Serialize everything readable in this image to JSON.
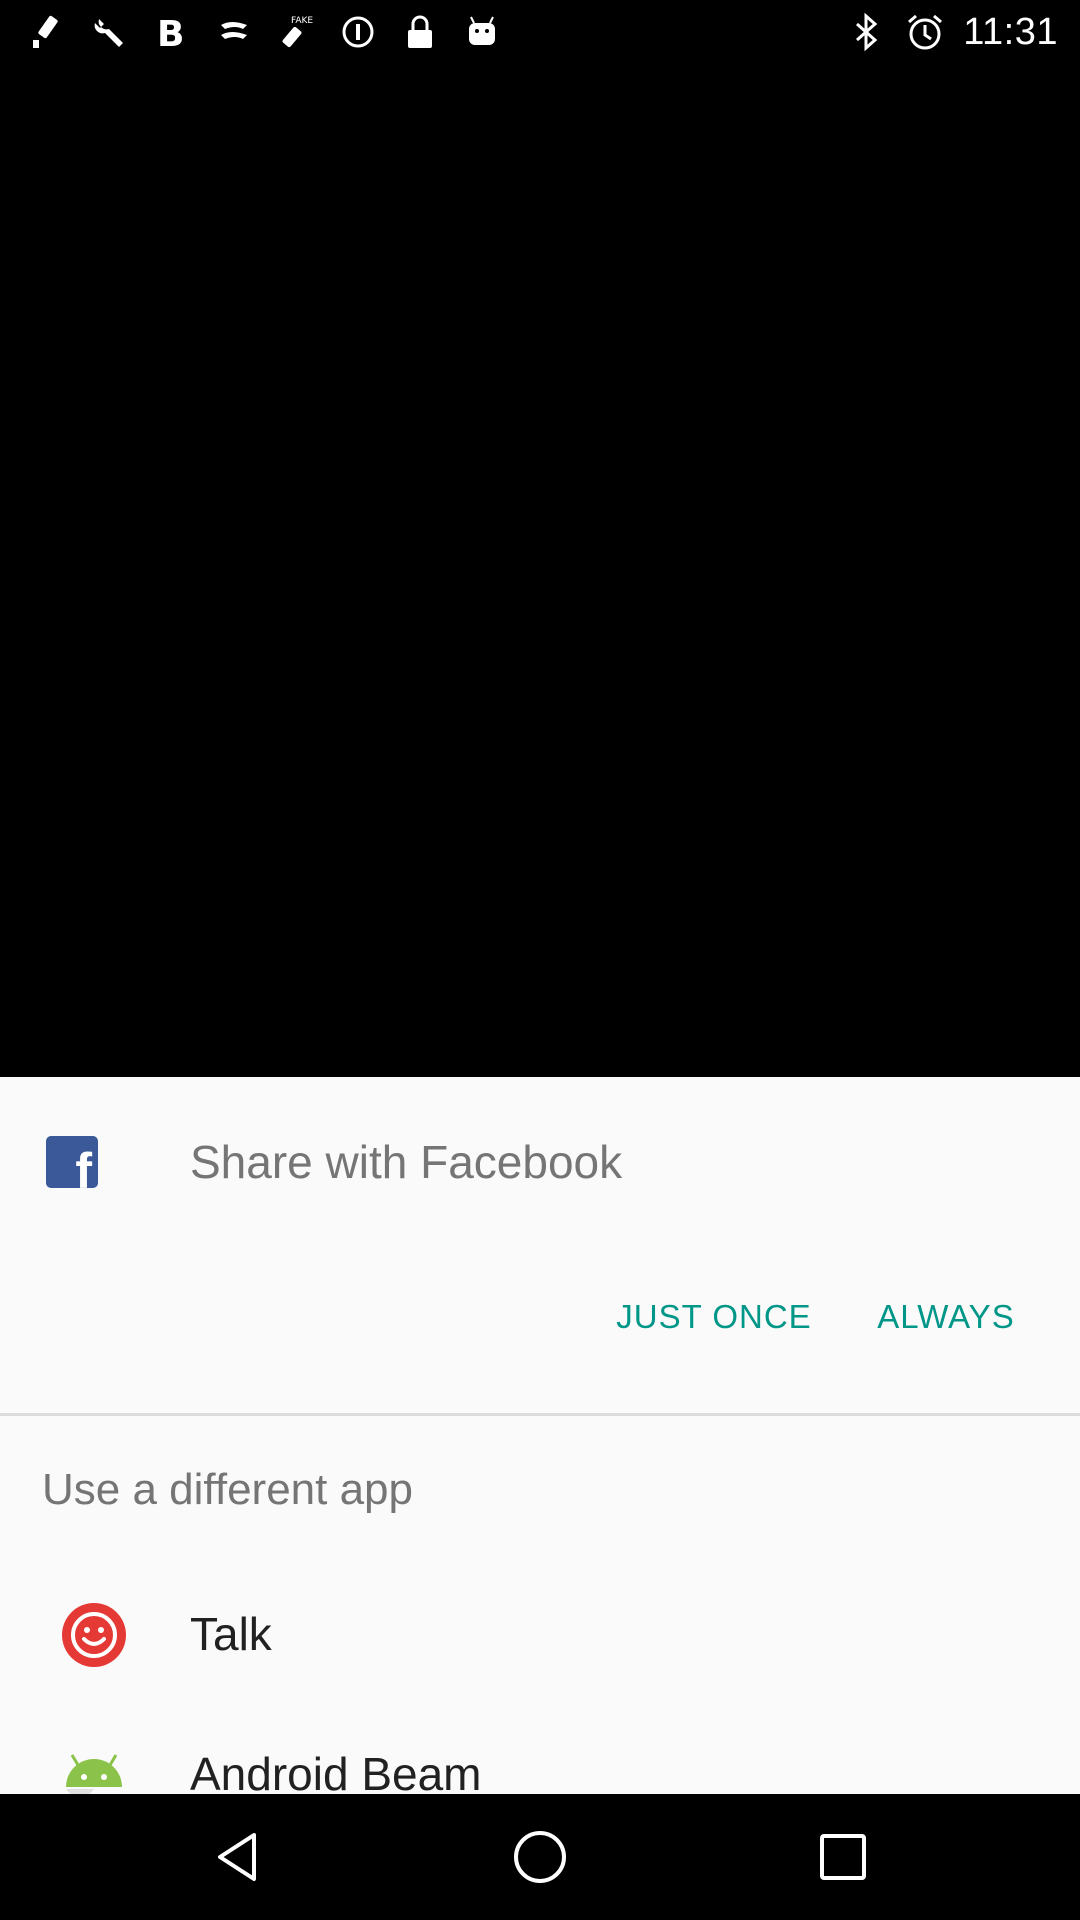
{
  "status_bar": {
    "time": "11:31",
    "left_icons": [
      "satellite-icon",
      "wrench-icon",
      "bold-b-icon",
      "fast-forward-icon",
      "fake-gps-icon",
      "circle-alert-icon",
      "lock-icon",
      "android-icon"
    ],
    "right_icons": [
      "bluetooth-icon",
      "alarm-clock-icon"
    ]
  },
  "share_sheet": {
    "title": "Share with Facebook",
    "app_icon": "facebook-icon",
    "just_once_label": "JUST ONCE",
    "always_label": "ALWAYS",
    "different_app_title": "Use a different app",
    "apps": [
      {
        "label": "Talk",
        "icon": "talk-smiley-icon"
      },
      {
        "label": "Android Beam",
        "icon": "android-beam-icon"
      }
    ]
  },
  "nav_bar": {
    "buttons": [
      "back-icon",
      "home-icon",
      "recents-icon"
    ]
  },
  "colors": {
    "accent": "#009688",
    "facebook": "#3b5998",
    "talk_red": "#e53935",
    "android_green": "#8bc34a",
    "sheet_background": "#fafafa",
    "secondary_text": "#757575",
    "primary_text": "#212121"
  }
}
